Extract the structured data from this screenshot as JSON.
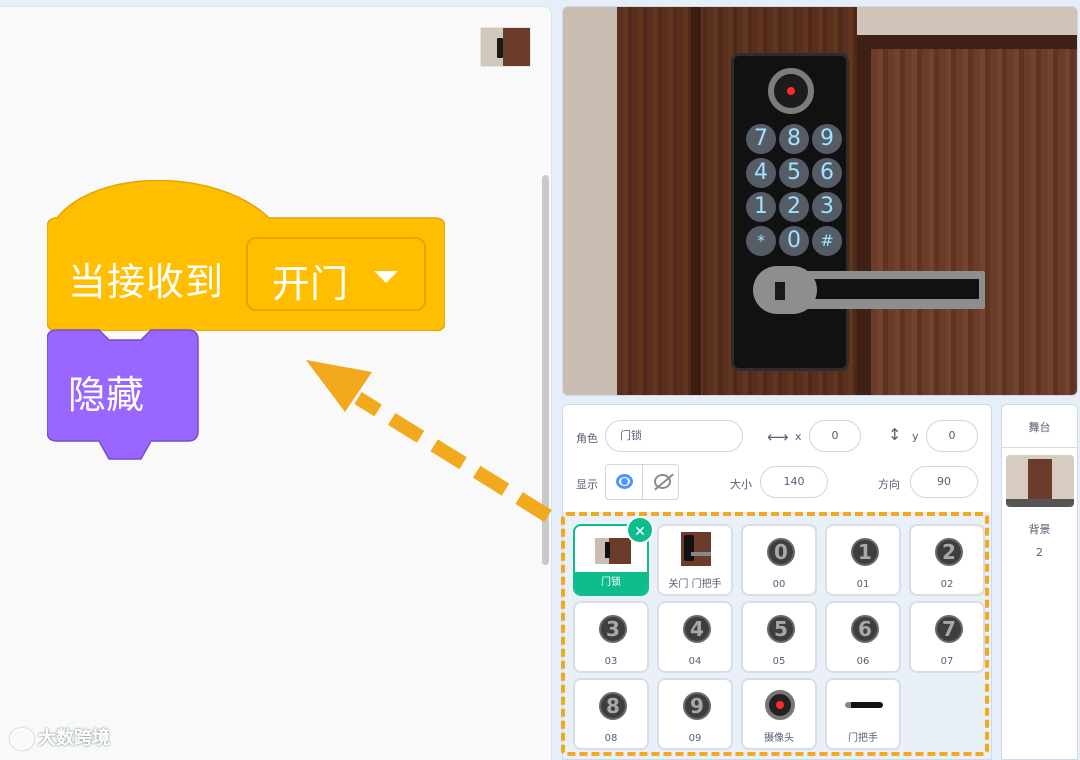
{
  "code": {
    "hat_block_label": "当接收到",
    "message_value": "开门",
    "hide_block_label": "隐藏"
  },
  "stage": {
    "keys": [
      "7",
      "8",
      "9",
      "4",
      "5",
      "6",
      "1",
      "2",
      "3",
      "*",
      "0",
      "#"
    ]
  },
  "sprite_info": {
    "sprite_label": "角色",
    "sprite_name": "门锁",
    "x_label": "x",
    "x_value": "0",
    "y_label": "y",
    "y_value": "0",
    "show_label": "显示",
    "size_label": "大小",
    "size_value": "140",
    "direction_label": "方向",
    "direction_value": "90"
  },
  "sprites": [
    {
      "name": "门锁",
      "thumb": "lock"
    },
    {
      "name": "关门 门把手",
      "thumb": "close-door"
    },
    {
      "name": "00",
      "digit": "0"
    },
    {
      "name": "01",
      "digit": "1"
    },
    {
      "name": "02",
      "digit": "2"
    },
    {
      "name": "03",
      "digit": "3"
    },
    {
      "name": "04",
      "digit": "4"
    },
    {
      "name": "05",
      "digit": "5"
    },
    {
      "name": "06",
      "digit": "6"
    },
    {
      "name": "07",
      "digit": "7"
    },
    {
      "name": "08",
      "digit": "8"
    },
    {
      "name": "09",
      "digit": "9"
    },
    {
      "name": "摄像头",
      "thumb": "camera"
    },
    {
      "name": "门把手",
      "thumb": "handle"
    }
  ],
  "stage_panel": {
    "title": "舞台",
    "backdrop_label": "背景",
    "backdrop_count": "2"
  },
  "watermark": "大数跨境",
  "colors": {
    "events_block": "#ffbf00",
    "looks_block": "#9966ff",
    "accent": "#0fbd8c",
    "annotation": "#f2a91d"
  }
}
